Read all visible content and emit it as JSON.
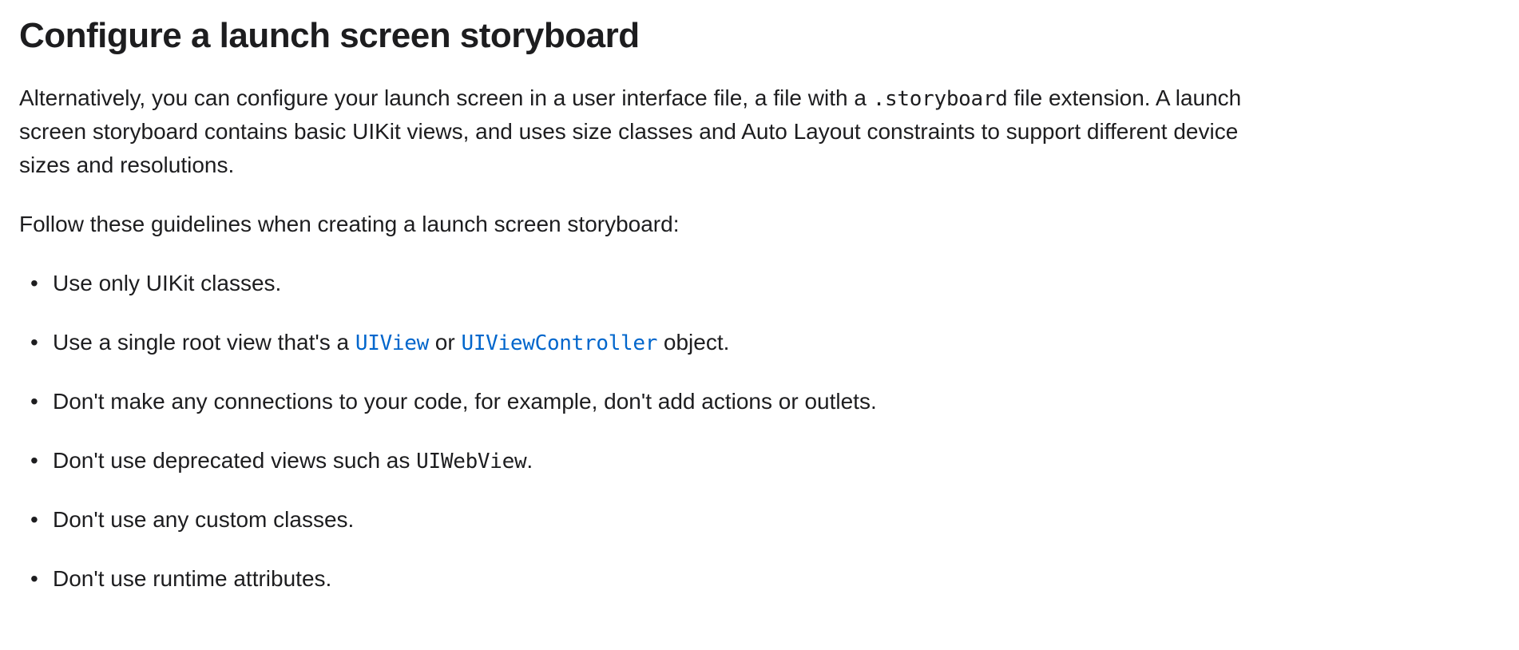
{
  "heading": "Configure a launch screen storyboard",
  "paragraph_1": {
    "prefix": "Alternatively, you can configure your launch screen in a user interface file, a file with a ",
    "code": ".storyboard",
    "suffix": " file extension. A launch screen storyboard contains basic UIKit views, and uses size classes and Auto Layout constraints to support different device sizes and resolutions."
  },
  "paragraph_2": "Follow these guidelines when creating a launch screen storyboard:",
  "list": {
    "item_0": "Use only UIKit classes.",
    "item_1": {
      "prefix": "Use a single root view that's a ",
      "link_a": "UIView",
      "middle": " or ",
      "link_b": "UIViewController",
      "suffix": " object."
    },
    "item_2": "Don't make any connections to your code, for example, don't add actions or outlets.",
    "item_3": {
      "prefix": "Don't use deprecated views such as ",
      "code": "UIWebView",
      "suffix": "."
    },
    "item_4": "Don't use any custom classes.",
    "item_5": "Don't use runtime attributes."
  }
}
